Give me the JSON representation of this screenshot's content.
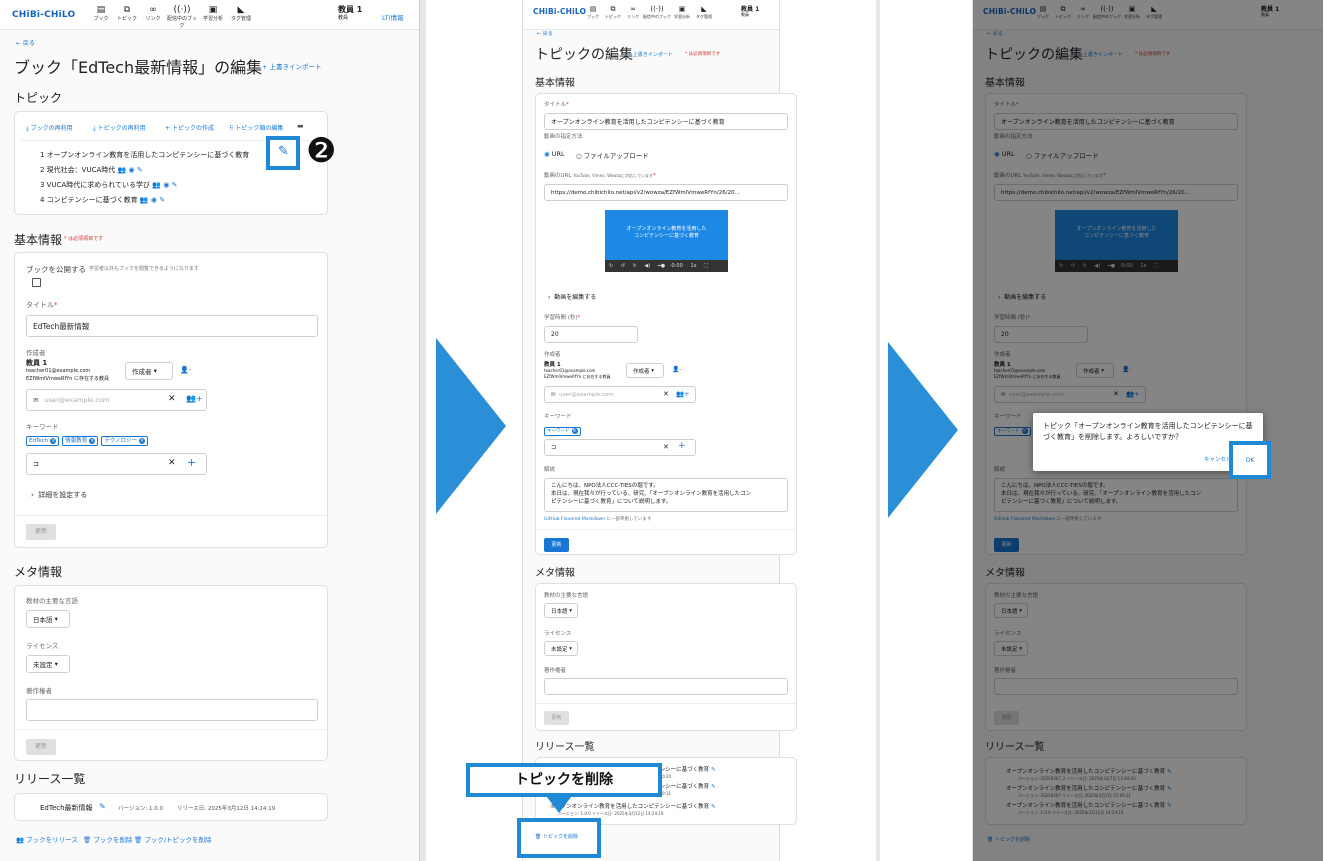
{
  "colors": {
    "accent": "#1976d2",
    "callout": "#1e8ad6",
    "required": "#d32f2f"
  },
  "app": {
    "logo": "CHiBi-CHiLO",
    "nav": [
      {
        "label": "ブック",
        "icon": "book-icon"
      },
      {
        "label": "トピック",
        "icon": "topic-icon"
      },
      {
        "label": "リンク",
        "icon": "link-icon"
      },
      {
        "label": "配信中のブック",
        "icon": "broadcast-icon"
      },
      {
        "label": "学習分析",
        "icon": "analytics-icon"
      },
      {
        "label": "タグ管理",
        "icon": "tag-icon"
      }
    ],
    "user_name": "教員 1",
    "user_role": "教員",
    "lti_link": "LTI情報"
  },
  "step1": {
    "back": "← 戻る",
    "page_title": "ブック「EdTech最新情報」の編集",
    "import_link": "+ 上書きインポート",
    "topic_section": "トピック",
    "toolbar": [
      "ブックの再利用",
      "トピックの再利用",
      "トピックの作成",
      "トピック順の編集"
    ],
    "topics": [
      "1 オープンオンライン教育を活用したコンピテンシーに基づく教育",
      "2 現代社会：VUCA時代",
      "3 VUCA時代に求められている学び",
      "4 コンピテンシーに基づく教育"
    ],
    "callout_number": "❷",
    "basic_info": "基本情報",
    "required_note": "* は必須項目です",
    "publish_label": "ブックを公開する",
    "publish_hint": "学習者以外もブックを閲覧できるようになります",
    "title_label": "タイトル",
    "title_value": "EdTech最新情報",
    "author_label": "作成者",
    "author_name": "教員 1",
    "author_email": "teacher01@example.com",
    "author_org": "EZfWmlVmweRfYn に存在する教員",
    "author_role": "作成者",
    "email_placeholder": "user@example.com",
    "keyword_label": "キーワード",
    "keywords": [
      "EdTech",
      "情報教育",
      "テクノロジー"
    ],
    "details_link": "詳細を設定する",
    "update_btn": "更新",
    "meta_section": "メタ情報",
    "lang_label": "教材の主要な言語",
    "lang_value": "日本語",
    "license_label": "ライセンス",
    "license_value": "未設定",
    "copyright_label": "著作権者",
    "release_section": "リリース一覧",
    "release_name": "EdTech最新情報",
    "release_version": "バージョン: 1.0.0",
    "release_date": "リリース日: 2025年3月12日 14:24:19",
    "footer_actions": [
      "ブックをリリース",
      "ブックを削除",
      "ブック/トピックを削除"
    ]
  },
  "step2": {
    "back": "← 戻る",
    "page_title": "トピックの編集",
    "import_link": "+ 上書きインポート",
    "required_note": "* は必須項目です",
    "basic_info": "基本情報",
    "title_label": "タイトル",
    "title_value": "オープンオンライン教育を活用したコンピテンシーに基づく教育",
    "video_method_label": "動画の指定方法",
    "radio_url": "URL",
    "radio_upload": "ファイルアップロード",
    "video_url_label": "動画のURL",
    "video_url_hint": "YouTube, Vimeo, Wowzaに対応しています",
    "video_url_value": "https://demo.chibichilo.net/api/v2/wowza/EZfWmlVmweRfYn/26/20…",
    "video_caption": "オープンオンライン教育を活用した\nコンピテンシーに基づく教育",
    "video_time": "-0:00",
    "video_speed": "1x",
    "edit_video": "動画を編集する",
    "duration_label": "学習時間 (秒)",
    "duration_value": "20",
    "author_label": "作成者",
    "author_name": "教員 1",
    "author_email": "teacher01@example.com",
    "author_org": "EZfWmlVmweRfYn に存在する教員",
    "author_role": "作成者",
    "email_placeholder": "user@example.com",
    "keyword_label": "キーワード",
    "keyword_chip": "キーワード",
    "description_label": "解説",
    "description_lines": [
      "こんにちは、NPO法人CCC-TIESの堀です。",
      "本日は、現在我々が行っている、研究、「オープンオンライン教育を活用したコン",
      "ピテンシーに基づく教育」について説明します。"
    ],
    "markdown_link": "GitHub Flavored Markdown",
    "markdown_hint": "に一部準拠しています",
    "update_btn": "更新",
    "meta_section": "メタ情報",
    "lang_label": "教材の主要な言語",
    "lang_value": "日本語",
    "license_label": "ライセンス",
    "license_value": "未設定",
    "copyright_label": "著作権者",
    "release_section": "リリース一覧",
    "releases": [
      {
        "title": "オープンオンライン教育を活用したコンピテンシーに基づく教育",
        "meta": "バージョン: 20250307   リリース日: 2025年3月7日 13:40:20"
      },
      {
        "title": "オープンオンライン教育を活用したコンピテンシーに基づく教育",
        "meta": "バージョン: 20250307   リリース日: 2025年3月7日 11:09:31"
      },
      {
        "title": "オープンオンライン教育を活用したコンピテンシーに基づく教育",
        "meta": "バージョン: 1.0.0   リリース日: 2025年3月12日 14:24:19"
      }
    ],
    "callout": "トピックを削除",
    "delete_btn": "トピックを削除"
  },
  "step3": {
    "dialog_message": "トピック「オープンオンライン教育を活用したコンピテンシーに基づく教育」を削除します。よろしいですか？",
    "cancel": "キャンセル",
    "ok": "OK",
    "release_meta": [
      "バージョン: 20250307_2   リリース日: 2025年3月7日 13:40:20",
      "バージョン: 20250307   リリース日: 2025年3月7日 11:09:31",
      "バージョン: 1.0.0   リリース日: 2025年3月12日 14:24:19"
    ]
  }
}
